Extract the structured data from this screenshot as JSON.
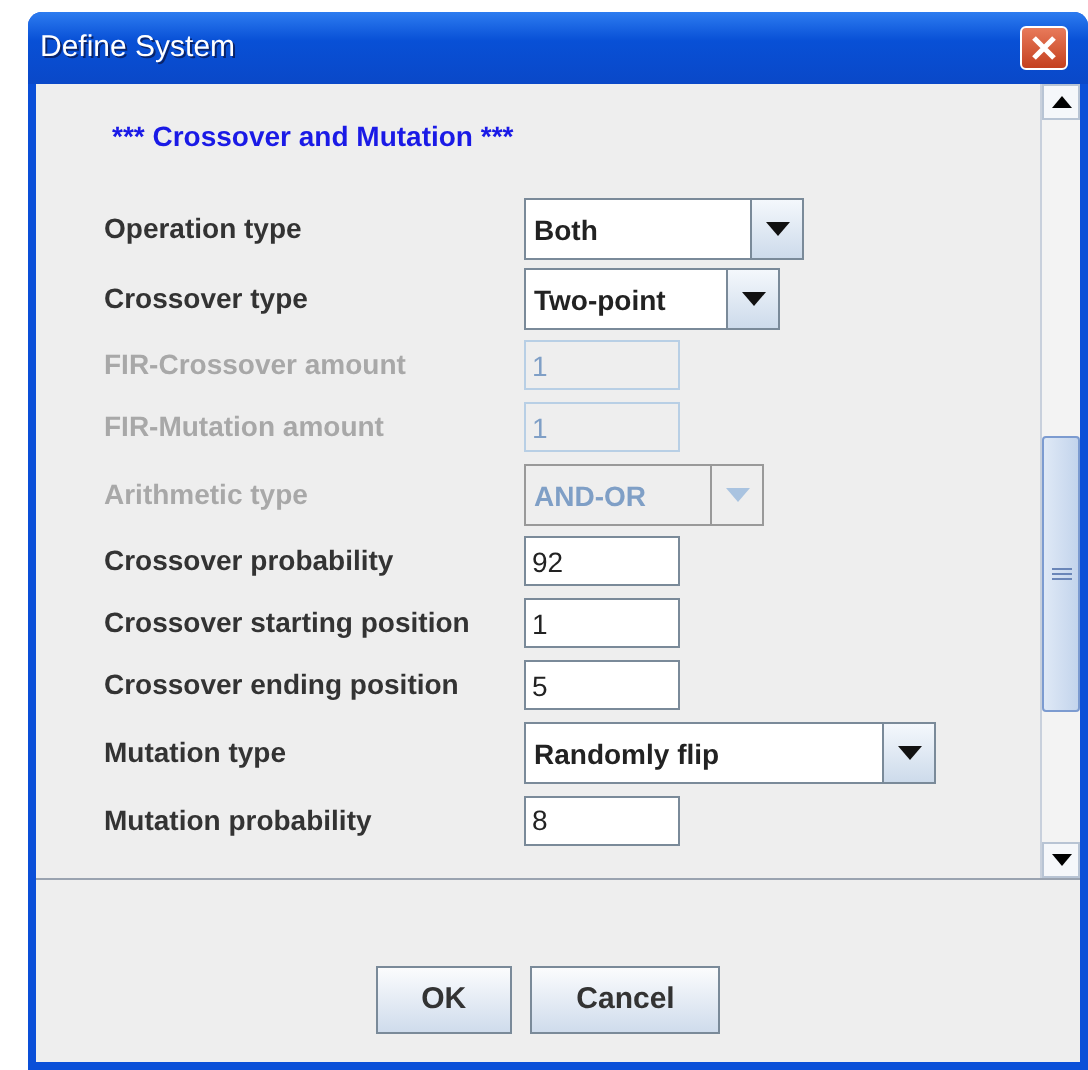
{
  "window": {
    "title": "Define System"
  },
  "section_title": "*** Crossover and Mutation ***",
  "fields": [
    {
      "label": "Operation type",
      "kind": "combo",
      "value": "Both",
      "disabled": false
    },
    {
      "label": "Crossover type",
      "kind": "combo",
      "value": "Two-point",
      "disabled": false
    },
    {
      "label": "FIR-Crossover amount",
      "kind": "text",
      "value": "1",
      "disabled": true
    },
    {
      "label": "FIR-Mutation amount",
      "kind": "text",
      "value": "1",
      "disabled": true
    },
    {
      "label": "Arithmetic type",
      "kind": "combo",
      "value": "AND-OR",
      "disabled": true
    },
    {
      "label": "Crossover probability",
      "kind": "text",
      "value": "92",
      "disabled": false
    },
    {
      "label": "Crossover starting position",
      "kind": "text",
      "value": "1",
      "disabled": false
    },
    {
      "label": "Crossover ending position",
      "kind": "text",
      "value": "5",
      "disabled": false
    },
    {
      "label": "Mutation type",
      "kind": "combo",
      "value": "Randomly flip",
      "disabled": false
    },
    {
      "label": "Mutation probability",
      "kind": "text",
      "value": "8",
      "disabled": false
    }
  ],
  "buttons": [
    "OK",
    "Cancel"
  ]
}
